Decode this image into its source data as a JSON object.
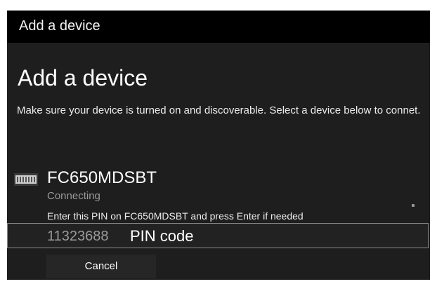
{
  "window": {
    "title": "Add a device"
  },
  "main": {
    "heading": "Add a device",
    "instructions": "Make sure your device is turned on and discoverable. Select a device below to connet."
  },
  "device": {
    "name": "FC650MDSBT",
    "status": "Connecting",
    "pin_instruction": "Enter this PIN on FC650MDSBT and press Enter if needed",
    "icon": "keyboard-icon"
  },
  "pin": {
    "value": "11323688",
    "label": "PIN code"
  },
  "actions": {
    "cancel_label": "Cancel"
  }
}
